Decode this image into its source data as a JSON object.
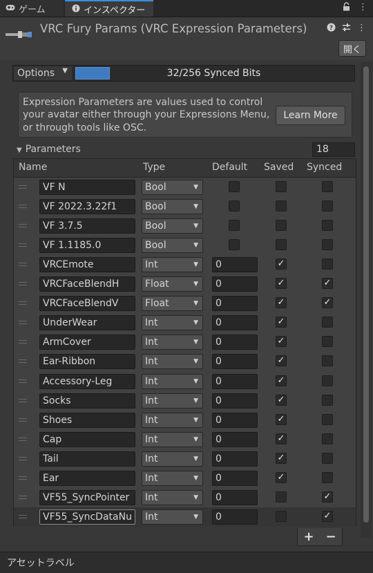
{
  "tabs": [
    {
      "label": "ゲーム",
      "icon": "gamepad-icon"
    },
    {
      "label": "インスペクター",
      "icon": "info-icon"
    }
  ],
  "component": {
    "title": "VRC Fury Params (VRC Expression Parameters)",
    "open_label": "開く"
  },
  "options": {
    "label": "Options",
    "synced_bits_text": "32/256 Synced Bits",
    "synced_bits_used": 32,
    "synced_bits_max": 256
  },
  "info": {
    "text": "Expression Parameters are values used to control your avatar either through your Expressions Menu, or through tools like OSC.",
    "learn_more": "Learn More"
  },
  "parameters": {
    "label": "Parameters",
    "count": "18",
    "columns": {
      "name": "Name",
      "type": "Type",
      "default": "Default",
      "saved": "Saved",
      "synced": "Synced"
    },
    "rows": [
      {
        "name": "VF N",
        "type": "Bool",
        "default": "",
        "saved": false,
        "synced": false
      },
      {
        "name": "VF 2022.3.22f1",
        "type": "Bool",
        "default": "",
        "saved": false,
        "synced": false
      },
      {
        "name": "VF 3.7.5",
        "type": "Bool",
        "default": "",
        "saved": false,
        "synced": false
      },
      {
        "name": "VF 1.1185.0",
        "type": "Bool",
        "default": "",
        "saved": false,
        "synced": false
      },
      {
        "name": "VRCEmote",
        "type": "Int",
        "default": "0",
        "saved": true,
        "synced": false
      },
      {
        "name": "VRCFaceBlendH",
        "type": "Float",
        "default": "0",
        "saved": true,
        "synced": true
      },
      {
        "name": "VRCFaceBlendV",
        "type": "Float",
        "default": "0",
        "saved": true,
        "synced": true
      },
      {
        "name": "UnderWear",
        "type": "Int",
        "default": "0",
        "saved": true,
        "synced": false
      },
      {
        "name": "ArmCover",
        "type": "Int",
        "default": "0",
        "saved": true,
        "synced": false
      },
      {
        "name": "Ear-Ribbon",
        "type": "Int",
        "default": "0",
        "saved": true,
        "synced": false
      },
      {
        "name": "Accessory-Leg",
        "type": "Int",
        "default": "0",
        "saved": true,
        "synced": false
      },
      {
        "name": "Socks",
        "type": "Int",
        "default": "0",
        "saved": true,
        "synced": false
      },
      {
        "name": "Shoes",
        "type": "Int",
        "default": "0",
        "saved": true,
        "synced": false
      },
      {
        "name": "Cap",
        "type": "Int",
        "default": "0",
        "saved": true,
        "synced": false
      },
      {
        "name": "Tail",
        "type": "Int",
        "default": "0",
        "saved": true,
        "synced": false
      },
      {
        "name": "Ear",
        "type": "Int",
        "default": "0",
        "saved": true,
        "synced": false
      },
      {
        "name": "VF55_SyncPointer",
        "type": "Int",
        "default": "0",
        "saved": false,
        "synced": true
      },
      {
        "name": "VF55_SyncDataNu",
        "type": "Int",
        "default": "0",
        "saved": false,
        "synced": true
      }
    ]
  },
  "footer": {
    "label": "アセットラベル"
  }
}
